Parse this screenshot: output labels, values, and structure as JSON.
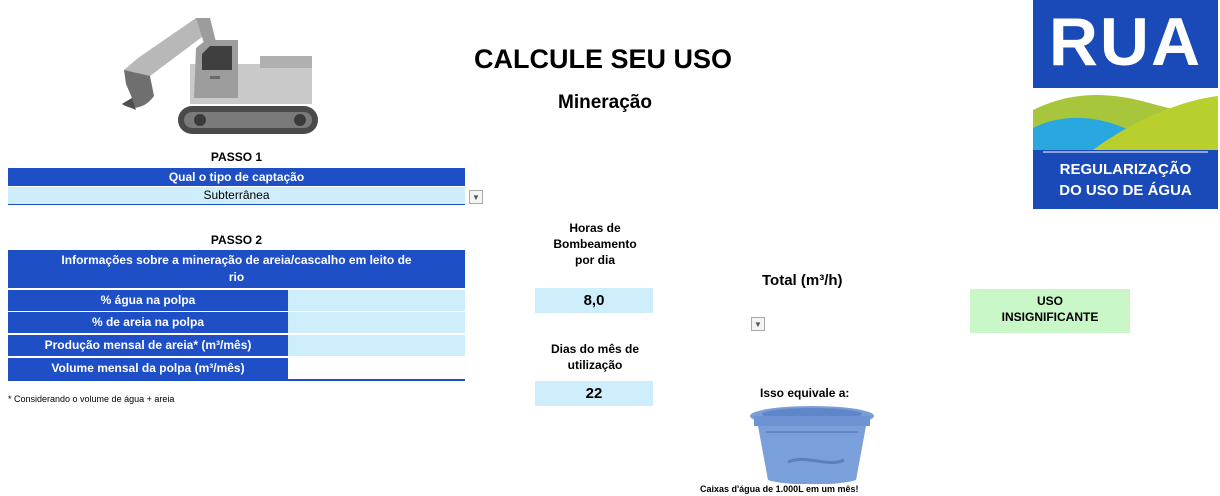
{
  "header": {
    "title": "CALCULE SEU USO",
    "subtitle": "Mineração"
  },
  "logo": {
    "name": "RUA",
    "tagline_line1": "REGULARIZAÇÃO",
    "tagline_line2": "DO USO DE ÁGUA"
  },
  "step1": {
    "label": "PASSO 1",
    "question": "Qual o tipo de captação",
    "selected": "Subterrânea"
  },
  "step2": {
    "label": "PASSO 2",
    "header_line1": "Informações sobre a mineração de areia/cascalho em leito de",
    "header_line2": "rio",
    "rows": [
      {
        "label": "% água na polpa",
        "value": ""
      },
      {
        "label": "% de areia na polpa",
        "value": ""
      },
      {
        "label": "Produção mensal de areia* (m³/mês)",
        "value": ""
      },
      {
        "label": "Volume mensal da polpa (m³/mês)",
        "value": ""
      }
    ],
    "footnote": "* Considerando o volume de água + areia"
  },
  "hours": {
    "label_line1": "Horas de",
    "label_line2": "Bombeamento",
    "label_line3": "por dia",
    "value": "8,0"
  },
  "days": {
    "label_line1": "Dias do mês de",
    "label_line2": "utilização",
    "value": "22"
  },
  "total": {
    "label": "Total (m³/h)"
  },
  "result": {
    "line1": "USO",
    "line2": "INSIGNIFICANTE"
  },
  "equivalence": {
    "label": "Isso equivale a:",
    "caption": "Caixas d'água de 1.000L em um mês!"
  },
  "colors": {
    "primary_blue": "#1f4fc7",
    "light_cell": "#cfeefb",
    "result_green": "#c9f7c7"
  },
  "icons": [
    "excavator-icon",
    "water-tank-icon",
    "dropdown-arrow-icon"
  ]
}
